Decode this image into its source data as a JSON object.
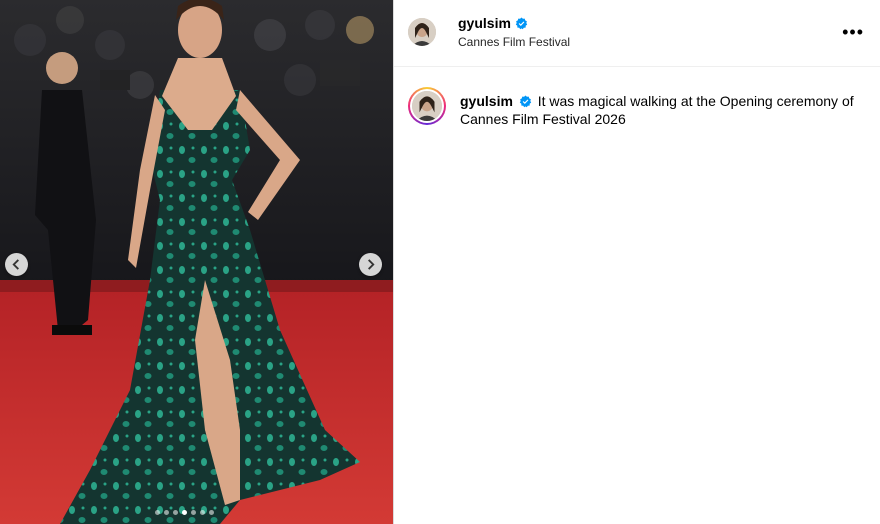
{
  "post": {
    "username": "gyulsim",
    "location": "Cannes Film Festival",
    "caption_text": "It was magical walking at the Opening ceremony of Cannes Film Festival 2026",
    "more_label": "•••"
  },
  "carousel": {
    "slide_count": 7,
    "active_index": 3
  },
  "icons": {
    "prev": "chevron-left-icon",
    "next": "chevron-right-icon",
    "verified": "verified-badge-icon",
    "more": "more-options-icon"
  },
  "colors": {
    "verified": "#0095f6",
    "red_carpet": "#c8282c",
    "dress": "#14302c",
    "dress_pattern": "#2aa386"
  }
}
